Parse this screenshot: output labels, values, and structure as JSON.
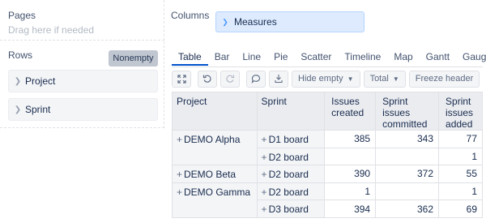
{
  "pages": {
    "title": "Pages",
    "hint": "Drag here if needed"
  },
  "rows": {
    "title": "Rows",
    "nonempty_label": "Nonempty",
    "items": [
      {
        "label": "Project"
      },
      {
        "label": "Sprint"
      }
    ]
  },
  "columns": {
    "title": "Columns",
    "measures_label": "Measures"
  },
  "viz_tabs": [
    "Table",
    "Bar",
    "Line",
    "Pie",
    "Scatter",
    "Timeline",
    "Map",
    "Gantt",
    "Gauge"
  ],
  "active_tab": "Table",
  "toolbar": {
    "hide_empty_label": "Hide empty",
    "total_label": "Total",
    "freeze_header_label": "Freeze header"
  },
  "table": {
    "headers": {
      "project": "Project",
      "sprint": "Sprint",
      "issues_created": "Issues created",
      "sprint_issues_committed": "Sprint issues committed",
      "sprint_issues_added": "Sprint issues added"
    },
    "rows": [
      {
        "project": "DEMO Alpha",
        "sprint": "D1 board",
        "issues_created": "385",
        "committed": "343",
        "added": "77"
      },
      {
        "project": "",
        "sprint": "D2 board",
        "issues_created": "",
        "committed": "",
        "added": "1"
      },
      {
        "project": "DEMO Beta",
        "sprint": "D2 board",
        "issues_created": "390",
        "committed": "372",
        "added": "55"
      },
      {
        "project": "DEMO Gamma",
        "sprint": "D2 board",
        "issues_created": "1",
        "committed": "",
        "added": "1"
      },
      {
        "project": "",
        "sprint": "D3 board",
        "issues_created": "394",
        "committed": "362",
        "added": "69"
      }
    ]
  }
}
